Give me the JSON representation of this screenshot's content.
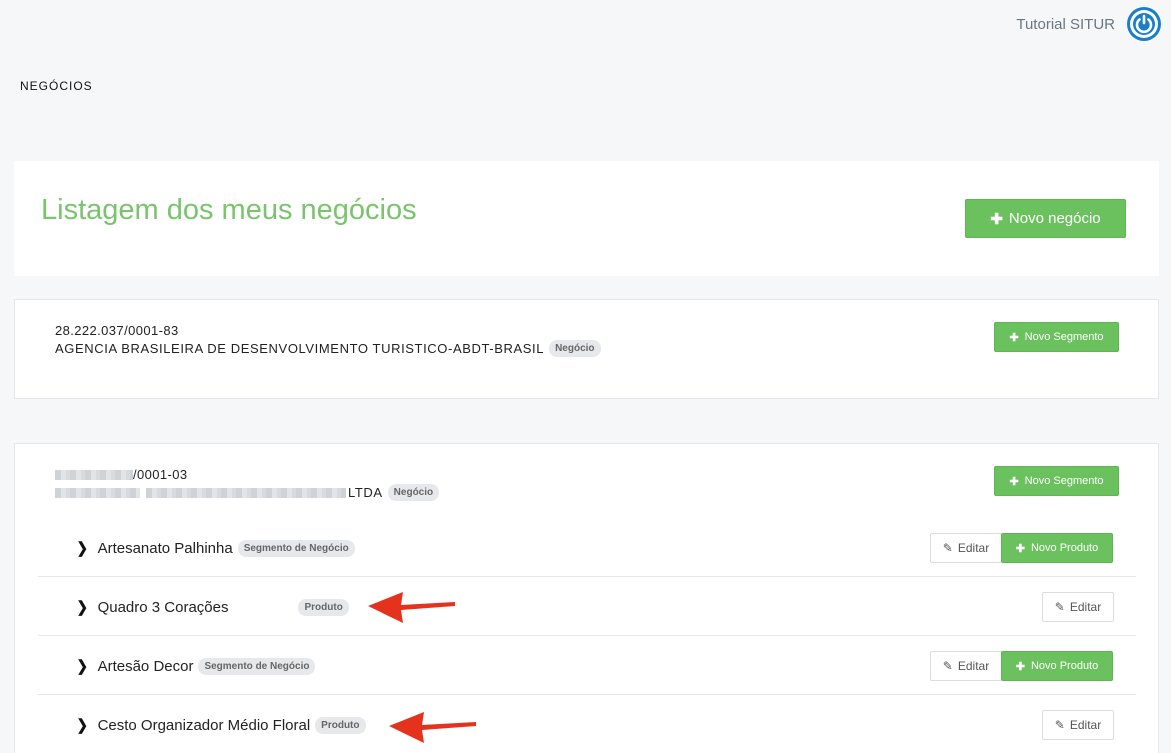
{
  "header": {
    "user_name": "Tutorial SITUR",
    "power_icon": "power-icon"
  },
  "breadcrumb": "NEGÓCIOS",
  "page": {
    "title": "Listagem dos meus negócios",
    "new_business_label": "Novo negócio"
  },
  "businesses": [
    {
      "cnpj": "28.222.037/0001-83",
      "name": "AGENCIA BRASILEIRA DE DESENVOLVIMENTO TURISTICO-ABDT-BRASIL",
      "badge": "Negócio",
      "new_segment_label": "Novo Segmento"
    },
    {
      "cnpj_suffix": "/0001-03",
      "name_suffix": "LTDA",
      "badge": "Negócio",
      "new_segment_label": "Novo Segmento",
      "rows": [
        {
          "label": "Artesanato Palhinha",
          "badge": "Segmento de Negócio",
          "edit_label": "Editar",
          "new_product_label": "Novo Produto"
        },
        {
          "label": "Quadro 3 Corações",
          "badge": "Produto",
          "edit_label": "Editar"
        },
        {
          "label": "Artesão Decor",
          "badge": "Segmento de Negócio",
          "edit_label": "Editar",
          "new_product_label": "Novo Produto"
        },
        {
          "label": "Cesto Organizador Médio Floral",
          "badge": "Produto",
          "edit_label": "Editar"
        }
      ]
    }
  ],
  "colors": {
    "accent_green": "#6cc15f",
    "title_green": "#79c56b",
    "power_blue": "#1a7fc8",
    "annotation_red": "#e5321d"
  }
}
